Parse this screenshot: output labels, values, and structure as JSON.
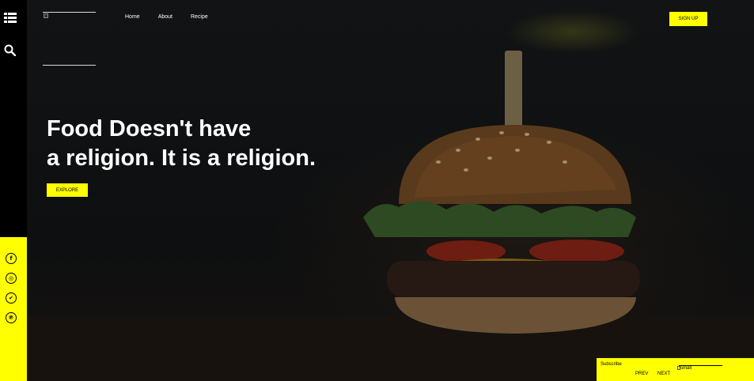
{
  "nav": {
    "items": [
      "Home",
      "About",
      "Recipe"
    ],
    "signup_label": "SIGN UP"
  },
  "hero": {
    "headline_line1": "Food Doesn't have",
    "headline_line2": "a religion. It is a religion.",
    "explore_label": "EXPLORE"
  },
  "sidebar": {
    "icons": [
      "menu-icon",
      "search-icon"
    ],
    "social": [
      {
        "name": "facebook-icon",
        "glyph": "f"
      },
      {
        "name": "instagram-icon",
        "glyph": "◎"
      },
      {
        "name": "twitter-icon",
        "glyph": "✔"
      },
      {
        "name": "pinterest-icon",
        "glyph": "℗"
      }
    ]
  },
  "footer": {
    "subscribe_label": "Subscribe",
    "prev_label": "PREV",
    "next_label": "NEXT",
    "small_image_alt": "small"
  },
  "colors": {
    "accent": "#ffff00",
    "sidebar": "#000000",
    "background": "#0b0b0b"
  }
}
